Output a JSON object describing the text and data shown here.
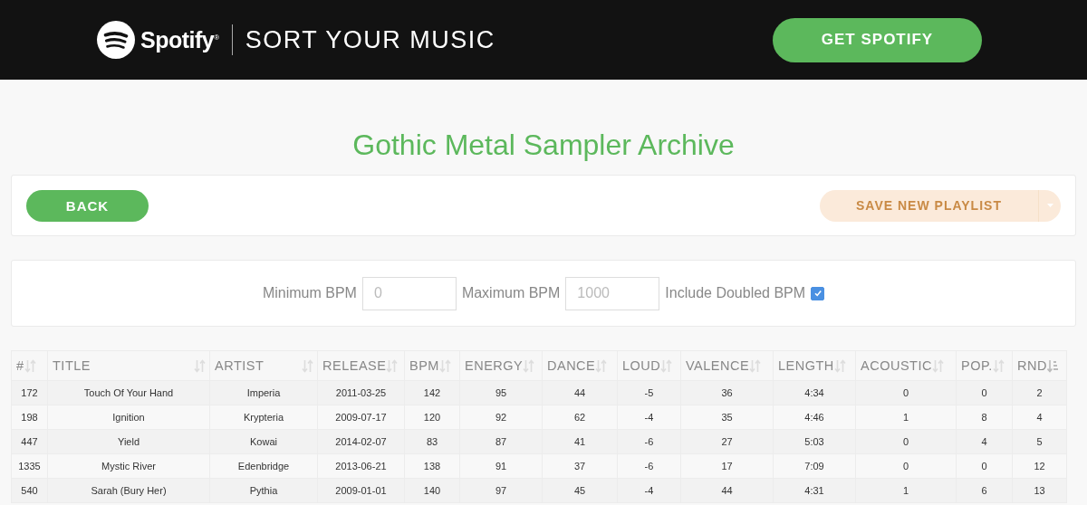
{
  "header": {
    "logo": "Spotify$^{®}$",
    "app_title": "SORT YOUR MUSIC",
    "cta": "GET SPOTIFY"
  },
  "page_title": "Gothic Metal Sampler Archive",
  "toolbar": {
    "back": "BACK",
    "save": {
      "label": "SAVE NEW PLAYLIST",
      "disabled": true
    }
  },
  "filters": {
    "min_label": "Minimum BPM",
    "min_placeholder": "0",
    "max_label": "Maximum BPM",
    "max_placeholder": "1000",
    "doubled_label": "Include Doubled BPM",
    "doubled_checked": true
  },
  "table": {
    "columns": [
      {
        "label": "#",
        "sorted": false
      },
      {
        "label": "TITLE",
        "sorted": false
      },
      {
        "label": "ARTIST",
        "sorted": false
      },
      {
        "label": "RELEASE",
        "sorted": false
      },
      {
        "label": "BPM",
        "sorted": false
      },
      {
        "label": "ENERGY",
        "sorted": false
      },
      {
        "label": "DANCE",
        "sorted": false
      },
      {
        "label": "LOUD",
        "sorted": false
      },
      {
        "label": "VALENCE",
        "sorted": false
      },
      {
        "label": "LENGTH",
        "sorted": false
      },
      {
        "label": "ACOUSTIC",
        "sorted": false
      },
      {
        "label": "POP.",
        "sorted": false
      },
      {
        "label": "RND",
        "sorted": true
      }
    ],
    "rows": [
      [
        "172",
        "Touch Of Your Hand",
        "Imperia",
        "2011-03-25",
        "142",
        "95",
        "44",
        "-5",
        "36",
        "4:34",
        "0",
        "0",
        "2"
      ],
      [
        "198",
        "Ignition",
        "Krypteria",
        "2009-07-17",
        "120",
        "92",
        "62",
        "-4",
        "35",
        "4:46",
        "1",
        "8",
        "4"
      ],
      [
        "447",
        "Yield",
        "Kowai",
        "2014-02-07",
        "83",
        "87",
        "41",
        "-6",
        "27",
        "5:03",
        "0",
        "4",
        "5"
      ],
      [
        "1335",
        "Mystic River",
        "Edenbridge",
        "2013-06-21",
        "138",
        "91",
        "37",
        "-6",
        "17",
        "7:09",
        "0",
        "0",
        "12"
      ],
      [
        "540",
        "Sarah (Bury Her)",
        "Pythia",
        "2009-01-01",
        "140",
        "97",
        "45",
        "-4",
        "44",
        "4:31",
        "1",
        "6",
        "13"
      ]
    ]
  }
}
